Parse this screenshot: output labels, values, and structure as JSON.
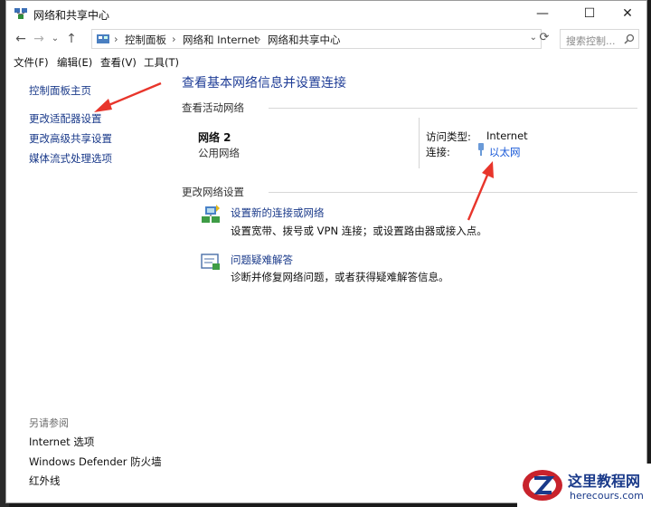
{
  "window": {
    "title": "网络和共享中心",
    "controls": {
      "minimize": "—",
      "maximize": "☐",
      "close": "✕"
    }
  },
  "addressbar": {
    "back": "←",
    "forward": "→",
    "dropdown": "⌄",
    "up": "↑",
    "breadcrumb": [
      "控制面板",
      "网络和 Internet",
      "网络和共享中心"
    ],
    "separator": "›",
    "refresh": "⟳",
    "search_placeholder": "搜索控制..."
  },
  "menubar": [
    "文件(F)",
    "编辑(E)",
    "查看(V)",
    "工具(T)"
  ],
  "sidebar": {
    "links": [
      "控制面板主页",
      "更改适配器设置",
      "更改高级共享设置",
      "媒体流式处理选项"
    ],
    "see_also_title": "另请参阅",
    "see_also": [
      "Internet 选项",
      "Windows Defender 防火墙",
      "红外线"
    ]
  },
  "main": {
    "heading": "查看基本网络信息并设置连接",
    "active_section": "查看活动网络",
    "network": {
      "name": "网络 2",
      "kind": "公用网络",
      "access_type_label": "访问类型:",
      "access_type_value": "Internet",
      "connection_label": "连接:",
      "connection_value": "以太网"
    },
    "change_section": "更改网络设置",
    "items": [
      {
        "link": "设置新的连接或网络",
        "desc": "设置宽带、拨号或 VPN 连接；或设置路由器或接入点。"
      },
      {
        "link": "问题疑难解答",
        "desc": "诊断并修复网络问题，或者获得疑难解答信息。"
      }
    ]
  },
  "watermark": {
    "title": "这里教程网",
    "url": "herecours.com"
  },
  "colors": {
    "link": "#1a3a8a",
    "heading": "#1e3c96",
    "annotation_arrow": "#e8352b"
  }
}
